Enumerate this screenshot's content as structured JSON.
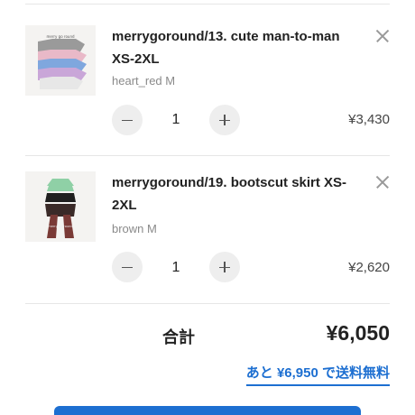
{
  "cart": {
    "items": [
      {
        "title": "merrygoround/13. cute man-to-man XS-2XL",
        "variant": "heart_red M",
        "quantity": "1",
        "price": "¥3,430"
      },
      {
        "title": "merrygoround/19. bootscut skirt XS-2XL",
        "variant": "brown M",
        "quantity": "1",
        "price": "¥2,620"
      }
    ],
    "total_label": "合計",
    "total_value": "¥6,050",
    "free_shipping_link": "あと ¥6,950 で送料無料"
  },
  "colors": {
    "accent": "#1d6fd1",
    "button_bg": "#eeeeee",
    "muted_text": "#8a8a8a"
  }
}
